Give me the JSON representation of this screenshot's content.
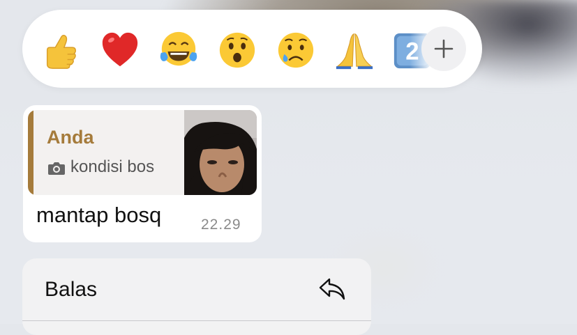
{
  "reactions": {
    "emojis": [
      "thumbs-up",
      "red-heart",
      "face-with-tears-of-joy",
      "face-with-open-mouth",
      "crying-face",
      "folded-hands",
      "keycap-partial"
    ],
    "keycap_char": "2",
    "more_button": "plus-icon"
  },
  "message": {
    "quote": {
      "sender": "Anda",
      "caption": "kondisi bos",
      "media_icon": "camera-icon"
    },
    "text": "mantap bosq",
    "time": "22.29"
  },
  "context_menu": {
    "items": [
      {
        "label": "Balas",
        "icon": "reply-arrow-icon"
      }
    ]
  },
  "colors": {
    "quote_accent": "#a57b3b",
    "bubble_bg": "#ffffff",
    "menu_bg": "#f2f2f3"
  }
}
